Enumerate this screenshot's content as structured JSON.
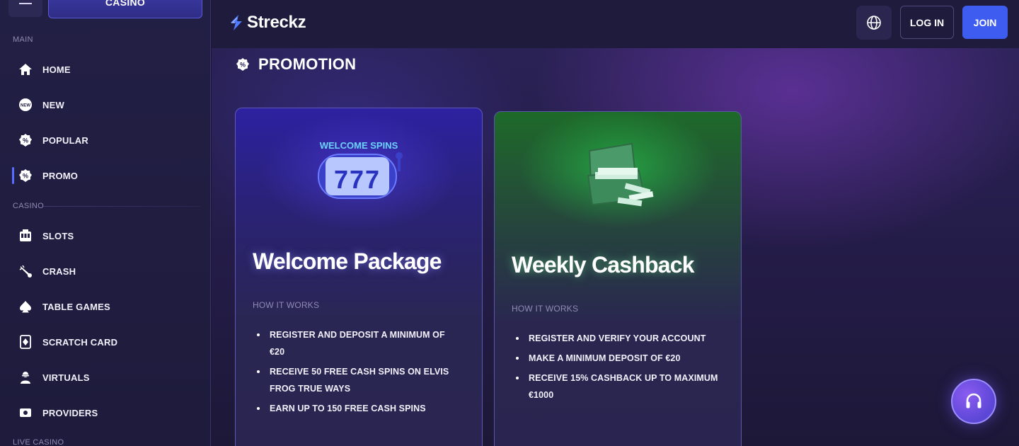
{
  "sidebar": {
    "casino_tab": "CASINO",
    "sections": {
      "main": "MAIN",
      "casino": "CASINO",
      "live_casino": "LIVE CASINO"
    },
    "items": [
      {
        "label": "HOME",
        "icon": "home-icon"
      },
      {
        "label": "NEW",
        "icon": "new-badge-icon"
      },
      {
        "label": "POPULAR",
        "icon": "percent-badge-icon"
      },
      {
        "label": "PROMO",
        "icon": "percent-badge-icon",
        "active": true
      },
      {
        "label": "SLOTS",
        "icon": "slot-machine-icon"
      },
      {
        "label": "CRASH",
        "icon": "rocket-icon"
      },
      {
        "label": "TABLE GAMES",
        "icon": "spade-icon"
      },
      {
        "label": "SCRATCH CARD",
        "icon": "scratch-card-icon"
      },
      {
        "label": "VIRTUALS",
        "icon": "virtual-icon"
      },
      {
        "label": "PROVIDERS",
        "icon": "providers-icon"
      }
    ]
  },
  "header": {
    "logo_text": "Streckz",
    "login_label": "LOG IN",
    "join_label": "JOIN",
    "accent_color": "#3f5cf0"
  },
  "main": {
    "heading": "PROMOTION",
    "cards": [
      {
        "title": "Welcome Package",
        "subtitle": "HOW IT WORKS",
        "art_label": "WELCOME SPINS",
        "art_digits": "777",
        "bullets": [
          "REGISTER AND DEPOSIT A MINIMUM OF €20",
          "RECEIVE 50 FREE CASH SPINS ON ELVIS FROG TRUE WAYS",
          "EARN UP TO 150 FREE CASH SPINS"
        ]
      },
      {
        "title": "Weekly Cashback",
        "subtitle": "HOW IT WORKS",
        "bullets": [
          "REGISTER AND VERIFY YOUR ACCOUNT",
          "MAKE A MINIMUM DEPOSIT OF €20",
          "RECEIVE 15% CASHBACK UP TO MAXIMUM €1000"
        ]
      }
    ]
  }
}
